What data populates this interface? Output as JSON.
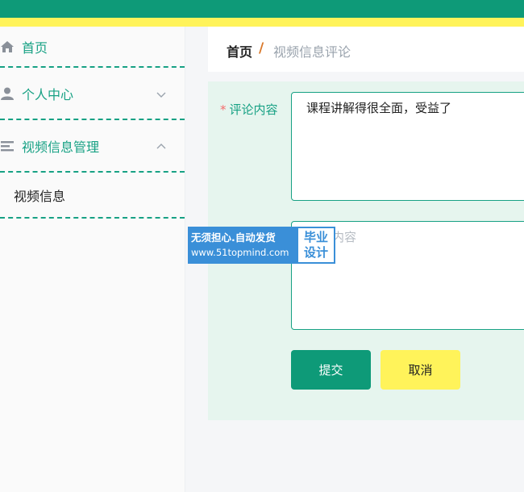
{
  "sidebar": {
    "items": [
      {
        "label": "首页",
        "icon": "home-icon"
      },
      {
        "label": "个人中心",
        "icon": "user-icon",
        "chevron": "chevron-down-icon"
      },
      {
        "label": "视频信息管理",
        "icon": "list-icon",
        "chevron": "chevron-up-icon"
      }
    ],
    "submenu": [
      {
        "label": "视频信息"
      }
    ]
  },
  "breadcrumb": {
    "home": "首页",
    "separator": "/",
    "current": "视频信息评论"
  },
  "form": {
    "comment_label": "评论内容",
    "required_mark": "*",
    "comment_value": "课程讲解得很全面，受益了",
    "second_placeholder": "内容",
    "submit_label": "提交",
    "cancel_label": "取消"
  },
  "watermark": {
    "line1": "无须担心.自动发货",
    "line2": "www.51topmind.com",
    "badge_line1": "毕业",
    "badge_line2": "设计"
  },
  "colors": {
    "primary": "#0e9a78",
    "accent": "#fff35a",
    "panel_bg": "#e6f5ee",
    "required": "#f56c6c",
    "separator": "#d9782a"
  }
}
